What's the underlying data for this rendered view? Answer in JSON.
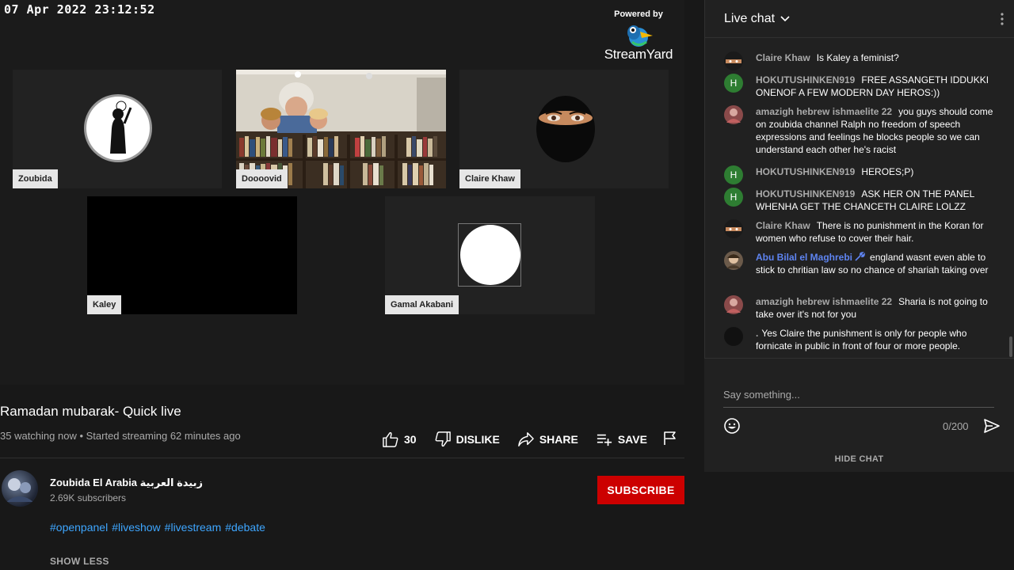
{
  "video": {
    "timestamp": "07 Apr 2022 23:12:52",
    "branding": {
      "powered_by": "Powered by",
      "name": "StreamYard"
    },
    "participants": [
      {
        "name": "Zoubida"
      },
      {
        "name": "Doooovid"
      },
      {
        "name": "Claire Khaw"
      },
      {
        "name": "Kaley"
      },
      {
        "name": "Gamal Akabani"
      }
    ]
  },
  "info": {
    "title": "Ramadan mubarak- Quick live",
    "meta": "35 watching now • Started streaming 62 minutes ago",
    "like_count": "30",
    "dislike_label": "DISLIKE",
    "share_label": "SHARE",
    "save_label": "SAVE"
  },
  "channel": {
    "name": "Zoubida El Arabia زبيدة العربية",
    "subscribers": "2.69K subscribers",
    "subscribe_label": "SUBSCRIBE",
    "hashtags": [
      "#openpanel",
      "#liveshow",
      "#livestream",
      "#debate"
    ],
    "show_less": "SHOW LESS"
  },
  "chat": {
    "title": "Live chat",
    "messages": [
      {
        "author": "Claire Khaw",
        "text": "Is Kaley a feminist?",
        "avatar": "",
        "avatar_color": "#1a1a1a"
      },
      {
        "author": "HOKUTUSHINKEN919",
        "text": "FREE ASSANGETH IDDUKKI ONENOF A FEW MODERN DAY HEROS:))",
        "avatar": "H",
        "avatar_color": "#2e7d32"
      },
      {
        "author": "amazigh hebrew ishmaelite 22",
        "text": "you guys should come on zoubida channel Ralph no freedom of speech expressions and feelings he blocks people so we can understand each other he's racist",
        "avatar": "",
        "avatar_color": "#8a4a4a"
      },
      {
        "author": "HOKUTUSHINKEN919",
        "text": "HEROES;P)",
        "avatar": "H",
        "avatar_color": "#2e7d32"
      },
      {
        "author": "HOKUTUSHINKEN919",
        "text": "ASK HER ON THE PANEL WHENHA GET THE CHANCETH CLAIRE LOLZZ",
        "avatar": "H",
        "avatar_color": "#2e7d32"
      },
      {
        "author": "Claire Khaw",
        "text": "There is no punishment in the Koran for women who refuse to cover their hair.",
        "avatar": "",
        "avatar_color": "#1a1a1a"
      },
      {
        "author": "Abu Bilal el Maghrebi",
        "text": "england wasnt even able to stick to chritian law so no chance of shariah taking over",
        "avatar": "",
        "avatar_color": "#6b5a4a",
        "moderator": true
      },
      {
        "author": "amazigh hebrew ishmaelite 22",
        "text": "Sharia is not going to take over it's not for you",
        "avatar": "",
        "avatar_color": "#8a4a4a"
      },
      {
        "author": ".",
        "text": "Yes Claire the punishment is only for people who fornicate in public in front of four or more people.",
        "avatar": "",
        "avatar_color": "#111111"
      }
    ],
    "input_placeholder": "Say something...",
    "char_count": "0/200",
    "hide_chat": "HIDE CHAT"
  }
}
